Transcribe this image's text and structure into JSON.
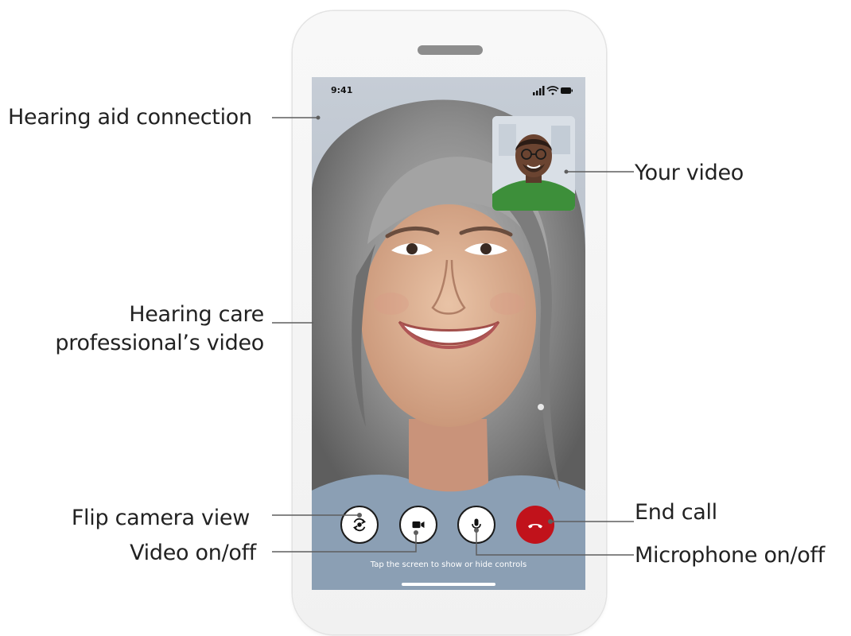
{
  "screen": {
    "status_time": "9:41",
    "tap_hint": "Tap the screen to show or hide controls"
  },
  "controls": [
    {
      "name": "flip-camera-button",
      "icon": "flip-camera-icon"
    },
    {
      "name": "video-toggle-button",
      "icon": "video-camera-icon"
    },
    {
      "name": "microphone-toggle-button",
      "icon": "microphone-icon"
    },
    {
      "name": "end-call-button",
      "icon": "phone-hangup-icon"
    }
  ],
  "labels": {
    "hearing_aid_connection": "Hearing aid connection",
    "your_video": "Your video",
    "hcp_video_line1": "Hearing care",
    "hcp_video_line2": "professional’s video",
    "flip_camera_view": "Flip camera view",
    "end_call": "End call",
    "video_on_off": "Video on/off",
    "microphone_on_off": "Microphone on/off"
  },
  "colors": {
    "end_call": "#c1121b",
    "phone_frame": "#f4f4f4",
    "label_text": "#222222"
  }
}
